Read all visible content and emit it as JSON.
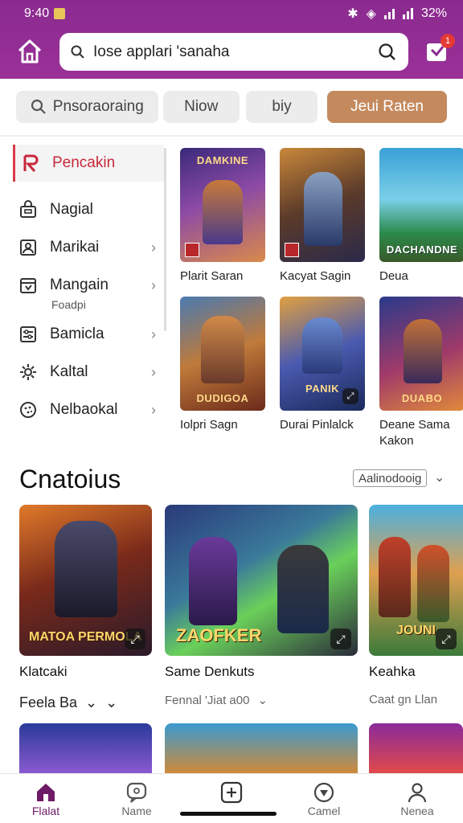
{
  "status_bar": {
    "time": "9:40",
    "battery": "32%"
  },
  "header": {
    "search_text": "Iose applari 'sanaha",
    "cart_badge": "1"
  },
  "filters": [
    {
      "label": "Pnsoraoraing"
    },
    {
      "label": "Niow"
    },
    {
      "label": "biy"
    },
    {
      "label": "Jeui Raten"
    }
  ],
  "sidebar": {
    "items": [
      {
        "label": "Pencakin"
      },
      {
        "label": "Nagial"
      },
      {
        "label": "Marikai"
      },
      {
        "label": "Mangain",
        "sub": "Foadpi"
      },
      {
        "label": "Bamicla"
      },
      {
        "label": "Kaltal"
      },
      {
        "label": "Nelbaokal"
      }
    ]
  },
  "products": [
    {
      "title": "Plarit Saran",
      "image_text": "DAMKINE"
    },
    {
      "title": "Kacyat Sagin",
      "image_text": ""
    },
    {
      "title": "Deua",
      "image_text": "DACHANDNE"
    },
    {
      "title": "Iolpri Sagn",
      "image_text": "DUDIGOA"
    },
    {
      "title": "Durai Pinlalck",
      "image_text": "PANIK"
    },
    {
      "title": "Deane Sama Kakon",
      "image_text": "DUABO"
    }
  ],
  "section": {
    "title": "Cnatoius",
    "sort_label": "Aalinodooig"
  },
  "games": [
    {
      "title": "Klatcaki",
      "image_text": "MATOA PERMOLA",
      "sub": "Feela Ba"
    },
    {
      "title": "Same Denkuts",
      "image_text": "ZAOFKER",
      "sub": "Fennal 'Jiat a00"
    },
    {
      "title": "Keahka",
      "image_text": "JOUNI",
      "sub": "Caat gn Llan"
    }
  ],
  "bottom_nav": [
    {
      "label": "Flalat",
      "icon": "house-icon",
      "active": true
    },
    {
      "label": "Name",
      "icon": "chat-icon",
      "active": false
    },
    {
      "label": "",
      "icon": "add-box-icon",
      "active": false
    },
    {
      "label": "Camel",
      "icon": "badge-icon",
      "active": false
    },
    {
      "label": "Nenea",
      "icon": "person-icon",
      "active": false
    }
  ],
  "colors": {
    "header": "#8a2a8f",
    "accent_button": "#c48a5e",
    "active_red": "#c8283a",
    "nav_active": "#6e1a66"
  }
}
